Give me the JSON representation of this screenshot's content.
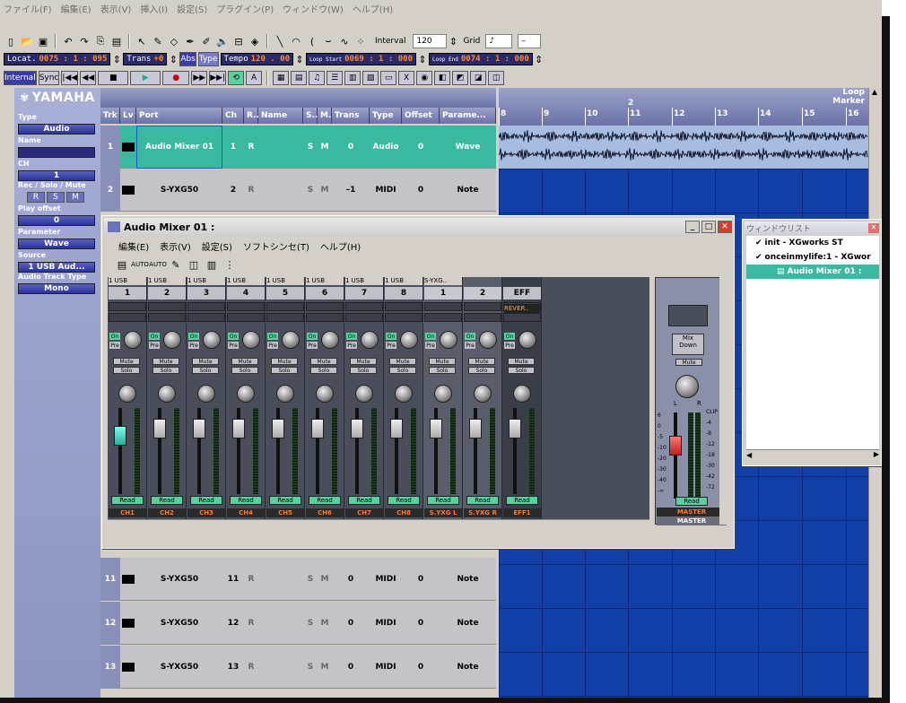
{
  "menu": {
    "items": [
      "ファイル(F)",
      "編集(E)",
      "表示(V)",
      "挿入(I)",
      "設定(S)",
      "プラグイン(P)",
      "ウィンドウ(W)",
      "ヘルプ(H)"
    ]
  },
  "toolbar": {
    "interval_label": "Interval",
    "interval_value": "120",
    "grid_label": "Grid",
    "grid_value": "♪",
    "grid_value2": "–"
  },
  "transport": {
    "locat_label": "Locat.",
    "locat_value": "0075 : 1 : 095",
    "trans_label": "Trans",
    "trans_value": "+0",
    "abs_label": "Abs",
    "type_label": "Type",
    "tempo_label": "Tempo",
    "tempo_value": "120 . 00",
    "loop_start_label": "Loop Start",
    "loop_start_value": "0069 : 1 : 000",
    "loop_end_label": "Loop End",
    "loop_end_value": "0074 : 1 : 000",
    "internal_label": "Internal",
    "sync_label": "Sync"
  },
  "left_panel": {
    "brand": "YAMAHA",
    "type_label": "Type",
    "type_value": "Audio",
    "name_label": "Name",
    "ch_label": "CH",
    "ch_value": "1",
    "rec_label": "Rec / Solo / Mute",
    "r": "R",
    "s": "S",
    "m": "M",
    "play_offset_label": "Play offset",
    "play_offset_value": "0",
    "parameter_label": "Parameter",
    "parameter_value": "Wave",
    "source_label": "Source",
    "source_value": "1 USB Aud...",
    "audio_track_type_label": "Audio Track Type",
    "audio_track_type_value": "Mono"
  },
  "track_header": {
    "columns": [
      "Trk",
      "Lv",
      "Port",
      "Ch",
      "R..",
      "Name",
      "S..",
      "M..",
      "Trans",
      "Type",
      "Offset",
      "Parame..."
    ],
    "loop_label": "Loop",
    "marker_label": "Marker",
    "bar_numbers": [
      "8",
      "9",
      "10",
      "11",
      "12",
      "13",
      "14",
      "15",
      "16"
    ],
    "ruler_top": "2"
  },
  "tracks": [
    {
      "trk": "1",
      "port": "Audio Mixer 01",
      "ch": "1",
      "r": "R",
      "s": "S",
      "m": "M",
      "trans": "0",
      "type": "Audio",
      "offset": "0",
      "param": "Wave"
    },
    {
      "trk": "2",
      "port": "S-YXG50",
      "ch": "2",
      "r": "R",
      "s": "S",
      "m": "M",
      "trans": "–1",
      "type": "MIDI",
      "offset": "0",
      "param": "Note"
    },
    {
      "trk": "11",
      "port": "S-YXG50",
      "ch": "11",
      "r": "R",
      "s": "S",
      "m": "M",
      "trans": "0",
      "type": "MIDI",
      "offset": "0",
      "param": "Note"
    },
    {
      "trk": "12",
      "port": "S-YXG50",
      "ch": "12",
      "r": "R",
      "s": "S",
      "m": "M",
      "trans": "0",
      "type": "MIDI",
      "offset": "0",
      "param": "Note"
    },
    {
      "trk": "13",
      "port": "S-YXG50",
      "ch": "13",
      "r": "R",
      "s": "S",
      "m": "M",
      "trans": "0",
      "type": "MIDI",
      "offset": "0",
      "param": "Note"
    }
  ],
  "mixer": {
    "title": "Audio Mixer 01 :",
    "menu": [
      "編集(E)",
      "表示(V)",
      "設定(S)",
      "ソフトシンセ(T)",
      "ヘルプ(H)"
    ],
    "channels": [
      {
        "input": "1 USB",
        "num": "1",
        "label": "CH1"
      },
      {
        "input": "1 USB",
        "num": "2",
        "label": "CH2"
      },
      {
        "input": "1 USB",
        "num": "3",
        "label": "CH3"
      },
      {
        "input": "1 USB",
        "num": "4",
        "label": "CH4"
      },
      {
        "input": "1 USB",
        "num": "5",
        "label": "CH5"
      },
      {
        "input": "1 USB",
        "num": "6",
        "label": "CH6"
      },
      {
        "input": "1 USB",
        "num": "7",
        "label": "CH7"
      },
      {
        "input": "1 USB",
        "num": "8",
        "label": "CH8"
      },
      {
        "input": "S-YXG..",
        "num": "1",
        "label": "S.YXG L"
      },
      {
        "input": "",
        "num": "2",
        "label": "S.YXG R"
      },
      {
        "input": "",
        "num": "EFF",
        "label": "EFF1"
      }
    ],
    "on_label": "On",
    "pre_label": "Pre",
    "mute_label": "Mute",
    "solo_label": "Solo",
    "read_label": "Read",
    "reverb_label": "REVER..",
    "master_label": "MASTER",
    "master_mixdown": "Mix Down",
    "master_clip": "CLIP",
    "master_scale": [
      "6",
      "0",
      "-5",
      "-10",
      "-20",
      "-30",
      "-40",
      "-∞"
    ],
    "master_scale_r": [
      "-4",
      "-8",
      "-12",
      "-18",
      "-30",
      "-42",
      "-72"
    ],
    "lr_l": "L",
    "lr_r": "R"
  },
  "window_list": {
    "title": "ウィンドウリスト",
    "items": [
      {
        "label": "init - XGworks ST",
        "level": 0
      },
      {
        "label": "onceinmylife:1 - XGwor",
        "level": 0
      },
      {
        "label": "Audio Mixer 01 :",
        "level": 1
      }
    ]
  },
  "colors": {
    "track_selected": "#3ab8a0",
    "grid_blue": "#1240a8",
    "lcd_orange": "#ff8a2a",
    "panel_violet": "#9aa2cc"
  }
}
